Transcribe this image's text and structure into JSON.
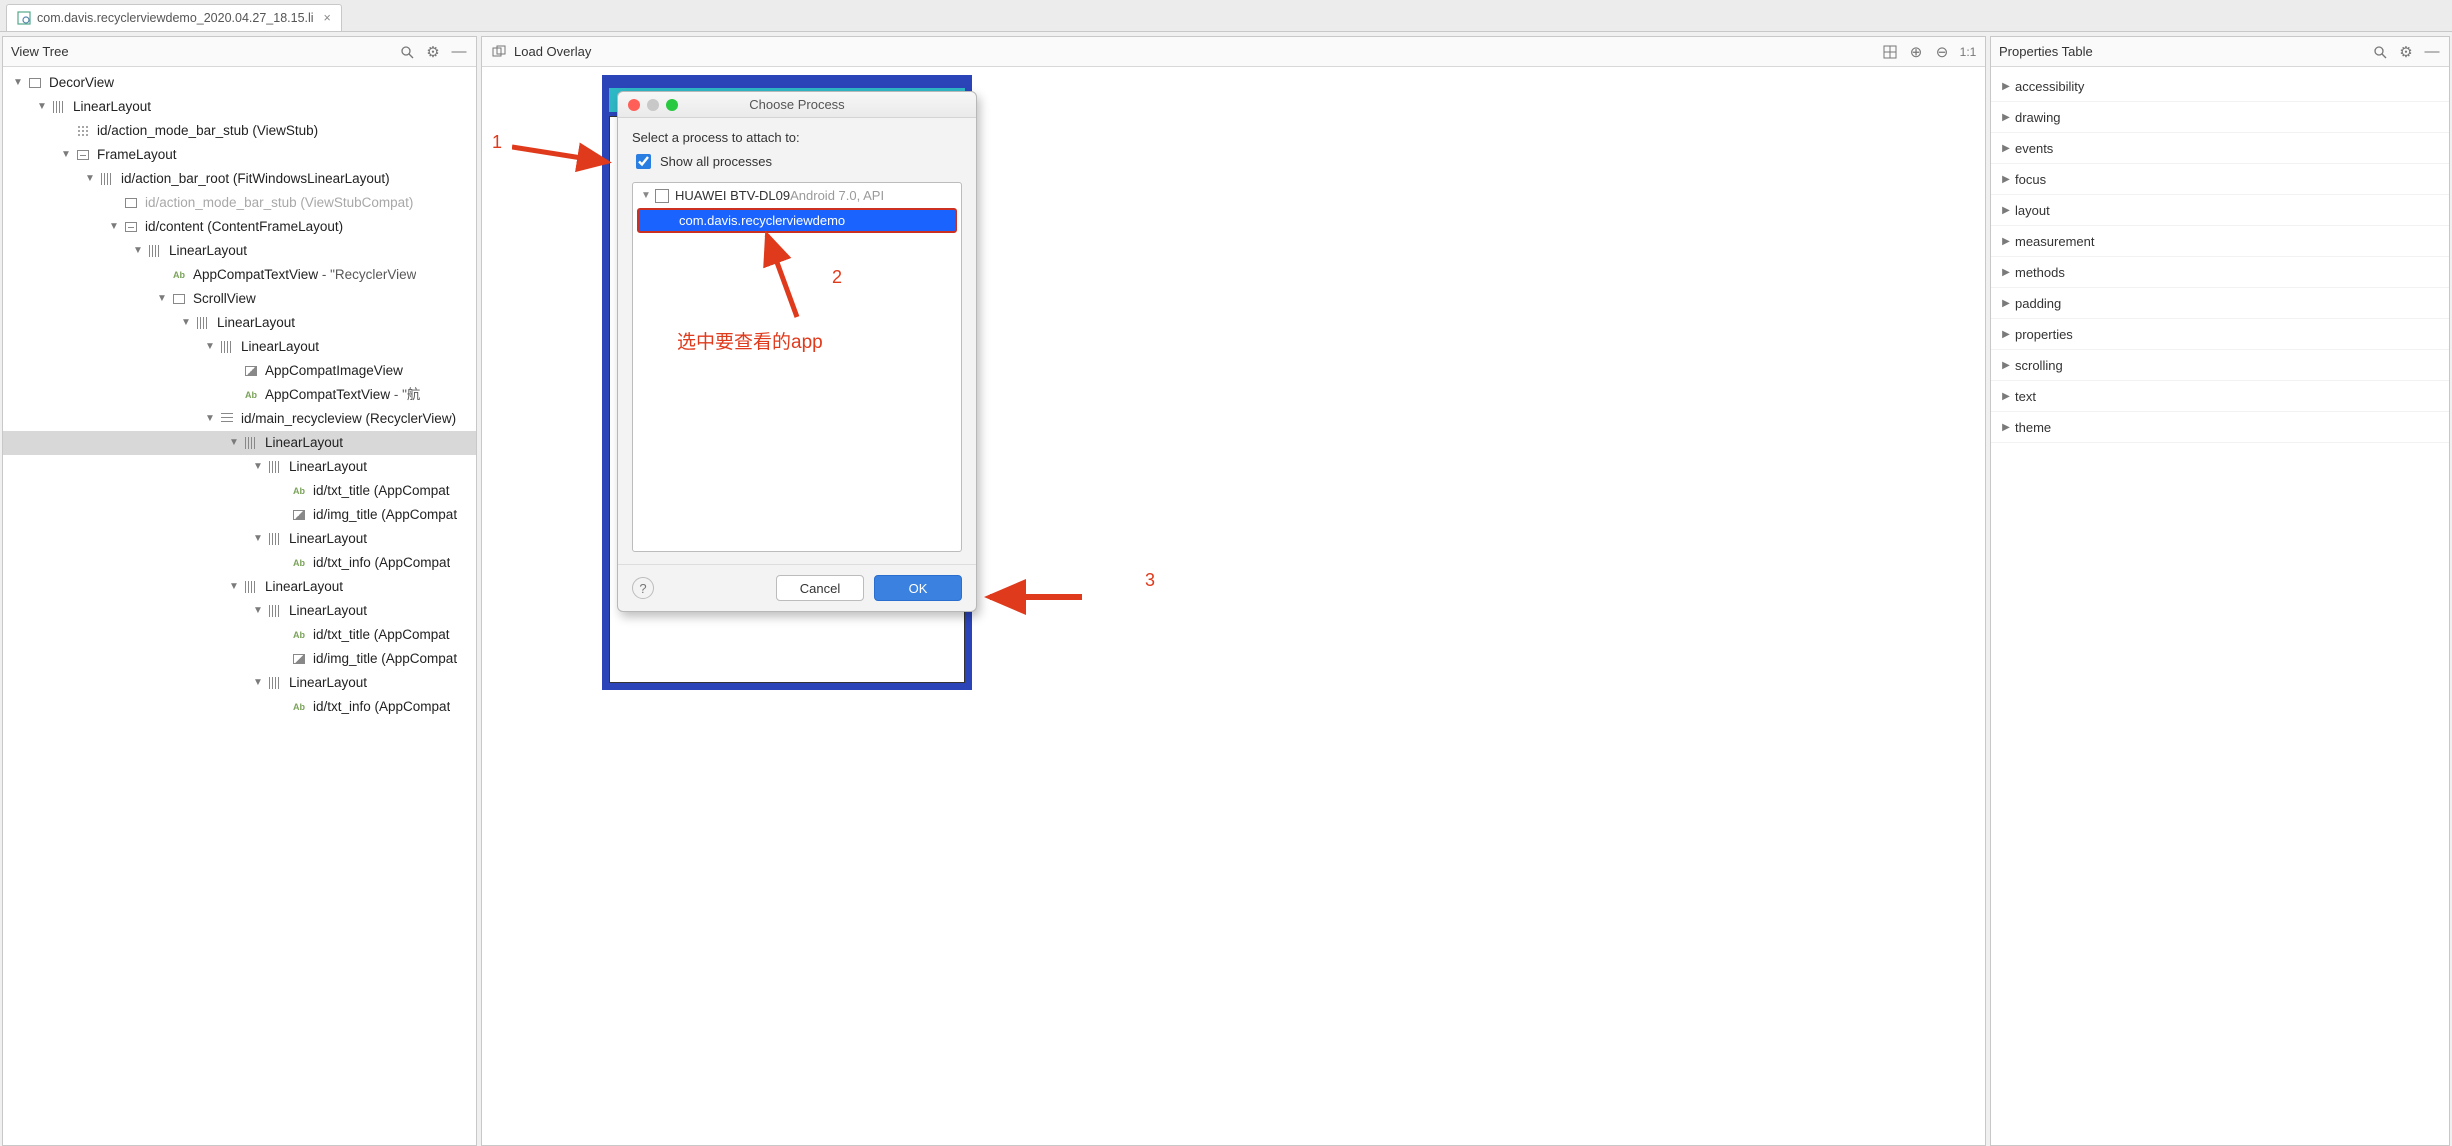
{
  "tab": {
    "title": "com.davis.recyclerviewdemo_2020.04.27_18.15.li"
  },
  "leftPanel": {
    "title": "View Tree"
  },
  "centerPanel": {
    "title": "Load Overlay"
  },
  "rightPanel": {
    "title": "Properties Table"
  },
  "tree": [
    {
      "d": 0,
      "icon": "box",
      "label": "DecorView",
      "open": true
    },
    {
      "d": 1,
      "icon": "vert",
      "label": "LinearLayout",
      "open": true
    },
    {
      "d": 2,
      "icon": "dots",
      "label": "id/action_mode_bar_stub (ViewStub)",
      "muted": false,
      "leaf": true
    },
    {
      "d": 2,
      "icon": "frame",
      "label": "FrameLayout",
      "open": true
    },
    {
      "d": 3,
      "icon": "vert",
      "label": "id/action_bar_root (FitWindowsLinearLayout)",
      "open": true
    },
    {
      "d": 4,
      "icon": "box",
      "label": "id/action_mode_bar_stub (ViewStubCompat)",
      "muted": true,
      "leaf": true
    },
    {
      "d": 4,
      "icon": "frame",
      "label": "id/content (ContentFrameLayout)",
      "open": true
    },
    {
      "d": 5,
      "icon": "vert",
      "label": "LinearLayout",
      "open": true
    },
    {
      "d": 6,
      "icon": "ab",
      "label": "AppCompatTextView",
      "extra": " - \"RecyclerView",
      "leaf": true
    },
    {
      "d": 6,
      "icon": "box",
      "label": "ScrollView",
      "open": true
    },
    {
      "d": 7,
      "icon": "vert",
      "label": "LinearLayout",
      "open": true
    },
    {
      "d": 8,
      "icon": "vert",
      "label": "LinearLayout",
      "open": true
    },
    {
      "d": 9,
      "icon": "img",
      "label": "AppCompatImageView",
      "leaf": true
    },
    {
      "d": 9,
      "icon": "ab",
      "label": "AppCompatTextView",
      "extra": " - \"航",
      "leaf": true
    },
    {
      "d": 8,
      "icon": "list",
      "label": "id/main_recycleview (RecyclerView)",
      "open": true
    },
    {
      "d": 9,
      "icon": "vert",
      "label": "LinearLayout",
      "open": true,
      "sel": true
    },
    {
      "d": 10,
      "icon": "vert",
      "label": "LinearLayout",
      "open": true
    },
    {
      "d": 11,
      "icon": "ab",
      "label": "id/txt_title (AppCompat",
      "leaf": true
    },
    {
      "d": 11,
      "icon": "img",
      "label": "id/img_title (AppCompat",
      "leaf": true
    },
    {
      "d": 10,
      "icon": "vert",
      "label": "LinearLayout",
      "open": true
    },
    {
      "d": 11,
      "icon": "ab",
      "label": "id/txt_info (AppCompat",
      "leaf": true
    },
    {
      "d": 9,
      "icon": "vert",
      "label": "LinearLayout",
      "open": true
    },
    {
      "d": 10,
      "icon": "vert",
      "label": "LinearLayout",
      "open": true
    },
    {
      "d": 11,
      "icon": "ab",
      "label": "id/txt_title (AppCompat",
      "leaf": true
    },
    {
      "d": 11,
      "icon": "img",
      "label": "id/img_title (AppCompat",
      "leaf": true
    },
    {
      "d": 10,
      "icon": "vert",
      "label": "LinearLayout",
      "open": true
    },
    {
      "d": 11,
      "icon": "ab",
      "label": "id/txt_info (AppCompat",
      "leaf": true
    }
  ],
  "dialog": {
    "title": "Choose Process",
    "label": "Select a process to attach to:",
    "checkbox": "Show all processes",
    "device": "HUAWEI BTV-DL09 ",
    "device_meta": "Android 7.0, API",
    "app": "com.davis.recyclerviewdemo",
    "cancel": "Cancel",
    "ok": "OK"
  },
  "annotations": {
    "one": "1",
    "two": "2",
    "three": "3",
    "select_app": "选中要查看的app"
  },
  "properties": [
    "accessibility",
    "drawing",
    "events",
    "focus",
    "layout",
    "measurement",
    "methods",
    "padding",
    "properties",
    "scrolling",
    "text",
    "theme"
  ]
}
